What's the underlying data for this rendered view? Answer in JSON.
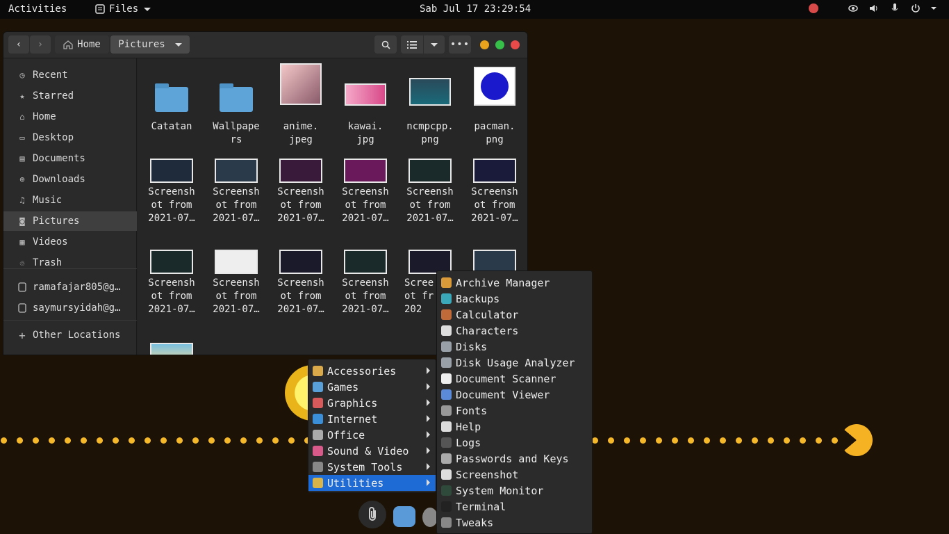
{
  "topbar": {
    "activities": "Activities",
    "app_name": "Files",
    "clock": "Sab Jul 17 23:29:54"
  },
  "window": {
    "breadcrumb_home": "Home",
    "breadcrumb_current": "Pictures"
  },
  "sidebar": {
    "items": [
      {
        "label": "Recent",
        "icon": "clock-icon"
      },
      {
        "label": "Starred",
        "icon": "star-icon"
      },
      {
        "label": "Home",
        "icon": "home-icon"
      },
      {
        "label": "Desktop",
        "icon": "desktop-icon"
      },
      {
        "label": "Documents",
        "icon": "documents-icon"
      },
      {
        "label": "Downloads",
        "icon": "download-icon"
      },
      {
        "label": "Music",
        "icon": "music-icon"
      },
      {
        "label": "Pictures",
        "icon": "camera-icon"
      },
      {
        "label": "Videos",
        "icon": "film-icon"
      },
      {
        "label": "Trash",
        "icon": "trash-icon"
      }
    ],
    "accounts": [
      "ramafajar805@g…",
      "saymursyidah@g…"
    ],
    "other_locations": "Other Locations"
  },
  "files": {
    "row1": [
      {
        "name": "Catatan",
        "kind": "folder"
      },
      {
        "name": "Wallpapers",
        "label1": "Wallpape",
        "label2": "rs",
        "kind": "folder"
      },
      {
        "name": "anime.jpeg",
        "label1": "anime.",
        "label2": "jpeg",
        "kind": "image"
      },
      {
        "name": "kawai.jpg",
        "label1": "kawai.",
        "label2": "jpg",
        "kind": "image"
      },
      {
        "name": "ncmpcpp.png",
        "label1": "ncmpcpp.",
        "label2": "png",
        "kind": "image"
      },
      {
        "name": "pacman.png",
        "label1": "pacman.",
        "label2": "png",
        "kind": "image"
      }
    ],
    "screenshot_label": [
      "Screensh",
      "ot from",
      "2021-07…"
    ],
    "partial_label": [
      "Scree",
      "ot fr",
      "202"
    ]
  },
  "menu_categories": [
    {
      "label": "Accessories",
      "color": "#d9a94a"
    },
    {
      "label": "Games",
      "color": "#5aa0d8"
    },
    {
      "label": "Graphics",
      "color": "#d85a5a"
    },
    {
      "label": "Internet",
      "color": "#3b8fd8"
    },
    {
      "label": "Office",
      "color": "#aaaaaa"
    },
    {
      "label": "Sound & Video",
      "color": "#d85a8a"
    },
    {
      "label": "System Tools",
      "color": "#888888"
    },
    {
      "label": "Utilities",
      "color": "#d9b44a"
    }
  ],
  "menu_selected": "Utilities",
  "menu_utilities": [
    {
      "label": "Archive Manager",
      "color": "#d99a3a"
    },
    {
      "label": "Backups",
      "color": "#3aa8b8"
    },
    {
      "label": "Calculator",
      "color": "#c06a3a"
    },
    {
      "label": "Characters",
      "color": "#dddddd"
    },
    {
      "label": "Disks",
      "color": "#9aa0a8"
    },
    {
      "label": "Disk Usage Analyzer",
      "color": "#9aa0a8"
    },
    {
      "label": "Document Scanner",
      "color": "#eeeeee"
    },
    {
      "label": "Document Viewer",
      "color": "#5a8ad8"
    },
    {
      "label": "Fonts",
      "color": "#999999"
    },
    {
      "label": "Help",
      "color": "#dddddd"
    },
    {
      "label": "Logs",
      "color": "#555555"
    },
    {
      "label": "Passwords and Keys",
      "color": "#aaaaaa"
    },
    {
      "label": "Screenshot",
      "color": "#dddddd"
    },
    {
      "label": "System Monitor",
      "color": "#2f4a3a"
    },
    {
      "label": "Terminal",
      "color": "#222222"
    },
    {
      "label": "Tweaks",
      "color": "#888888"
    }
  ]
}
